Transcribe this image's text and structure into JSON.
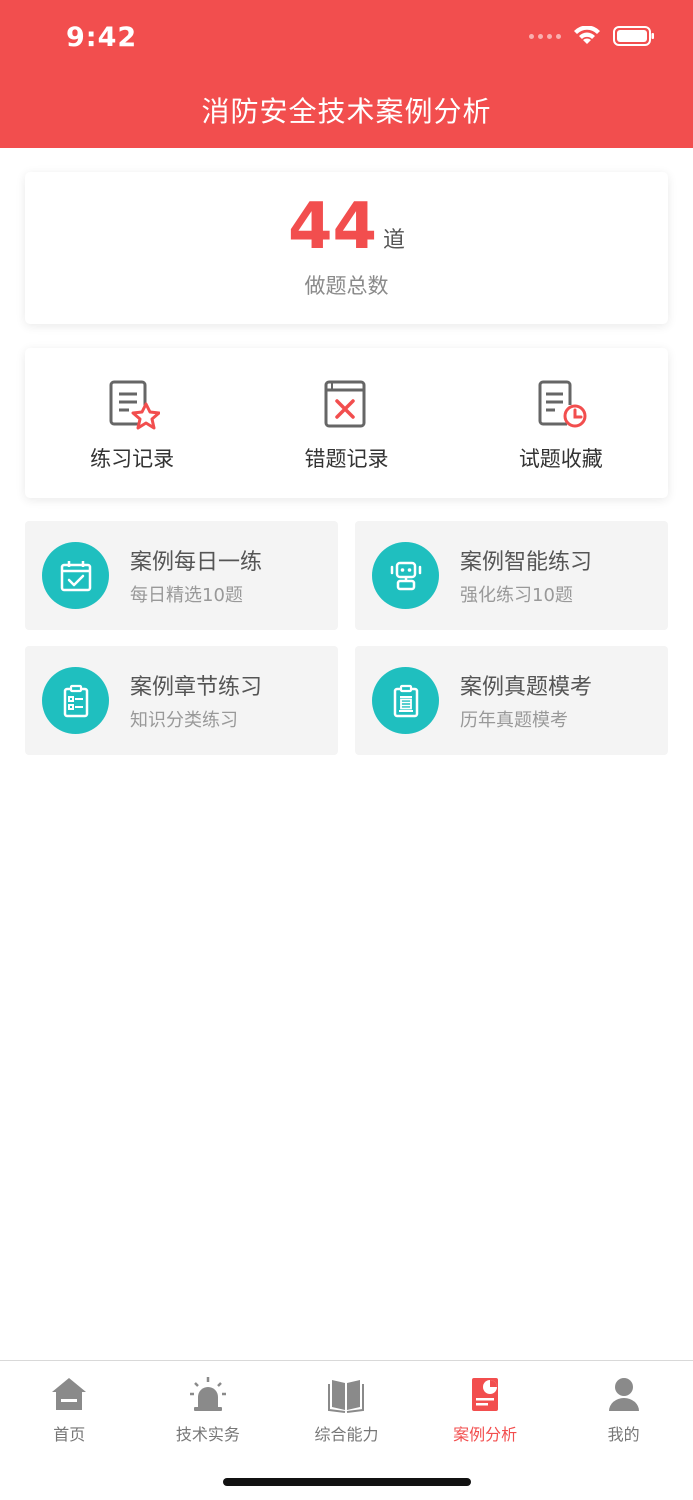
{
  "status_bar": {
    "time": "9:42"
  },
  "header": {
    "title": "消防安全技术案例分析"
  },
  "summary": {
    "count": "44",
    "unit": "道",
    "label": "做题总数"
  },
  "records": [
    {
      "label": "练习记录",
      "icon": "doc-star-icon"
    },
    {
      "label": "错题记录",
      "icon": "book-x-icon"
    },
    {
      "label": "试题收藏",
      "icon": "doc-clock-icon"
    }
  ],
  "tiles": [
    {
      "title": "案例每日一练",
      "subtitle": "每日精选10题",
      "icon": "calendar-check-icon"
    },
    {
      "title": "案例智能练习",
      "subtitle": "强化练习10题",
      "icon": "robot-icon"
    },
    {
      "title": "案例章节练习",
      "subtitle": "知识分类练习",
      "icon": "clipboard-list-icon"
    },
    {
      "title": "案例真题模考",
      "subtitle": "历年真题模考",
      "icon": "clipboard-zhen-icon"
    }
  ],
  "tab_bar": {
    "active_index": 3,
    "tabs": [
      {
        "label": "首页",
        "icon": "home-icon"
      },
      {
        "label": "技术实务",
        "icon": "alarm-light-icon"
      },
      {
        "label": "综合能力",
        "icon": "open-book-icon"
      },
      {
        "label": "案例分析",
        "icon": "report-chart-icon"
      },
      {
        "label": "我的",
        "icon": "user-icon"
      }
    ]
  },
  "colors": {
    "brand": "#f24e4e",
    "teal": "#1fbfbf",
    "tab_inactive": "#8a8a8a"
  }
}
